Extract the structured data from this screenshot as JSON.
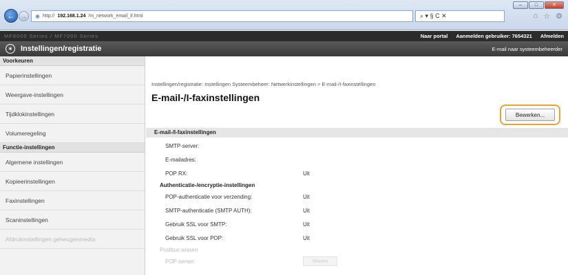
{
  "browser": {
    "url_prefix": "http://",
    "url_host": "192.168.1.24",
    "url_path": "/m_network_email_if.html",
    "address_tools": "⌕ ▾ § C ✕",
    "win_min": "–",
    "win_max": "□",
    "win_close": "✕",
    "icon_home": "⌂",
    "icon_star": "☆",
    "icon_gear": "⚙"
  },
  "header": {
    "device_name": "MF8000 Series / MF7000 Series",
    "portal_link": "Naar portal",
    "user_label": "Aanmelden gebruiker:",
    "user_id": "7654321",
    "logout_link": "Afmelden",
    "app_title": "Instellingen/registratie",
    "mail_admin_link": "E-mail naar systeembeheerder"
  },
  "sidebar": {
    "groups": [
      {
        "label": "Voorkeuren",
        "items": [
          "Papierinstellingen",
          "Weergave-instellingen",
          "Tijdklokinstellingen",
          "Volumeregeling"
        ]
      },
      {
        "label": "Functie-instellingen",
        "items": [
          "Algemene instellingen",
          "Kopieerinstellingen",
          "Faxinstellingen",
          "Scaninstellingen",
          "Afdrukinstellingen geheugenmedia"
        ]
      }
    ]
  },
  "main": {
    "breadcrumb": "Instellingen/registratie: Instellingen Systeembeheer: Netwerkinstellingen > E-mail-/I-faxinstellingen",
    "page_title": "E-mail-/I-faxinstellingen",
    "edit_button": "Bewerken...",
    "section_title": "E-mail-/I-faxinstellingen",
    "rows": [
      {
        "label": "SMTP-server:",
        "value": ""
      },
      {
        "label": "E-mailadres:",
        "value": ""
      },
      {
        "label": "POP RX:",
        "value": "Uit"
      }
    ],
    "auth_title": "Authenticatie-/encryptie-instellingen",
    "auth_rows": [
      {
        "label": "POP-authenticatie voor verzending:",
        "value": "Uit"
      },
      {
        "label": "SMTP-authenticatie (SMTP AUTH):",
        "value": "Uit"
      },
      {
        "label": "Gebruik SSL voor SMTP:",
        "value": "Uit"
      },
      {
        "label": "Gebruik SSL voor POP:",
        "value": "Uit"
      }
    ],
    "mailbox_title": "Postbus wissen",
    "pop_server_label": "POP-server:",
    "wipe_button": "Wissen"
  }
}
